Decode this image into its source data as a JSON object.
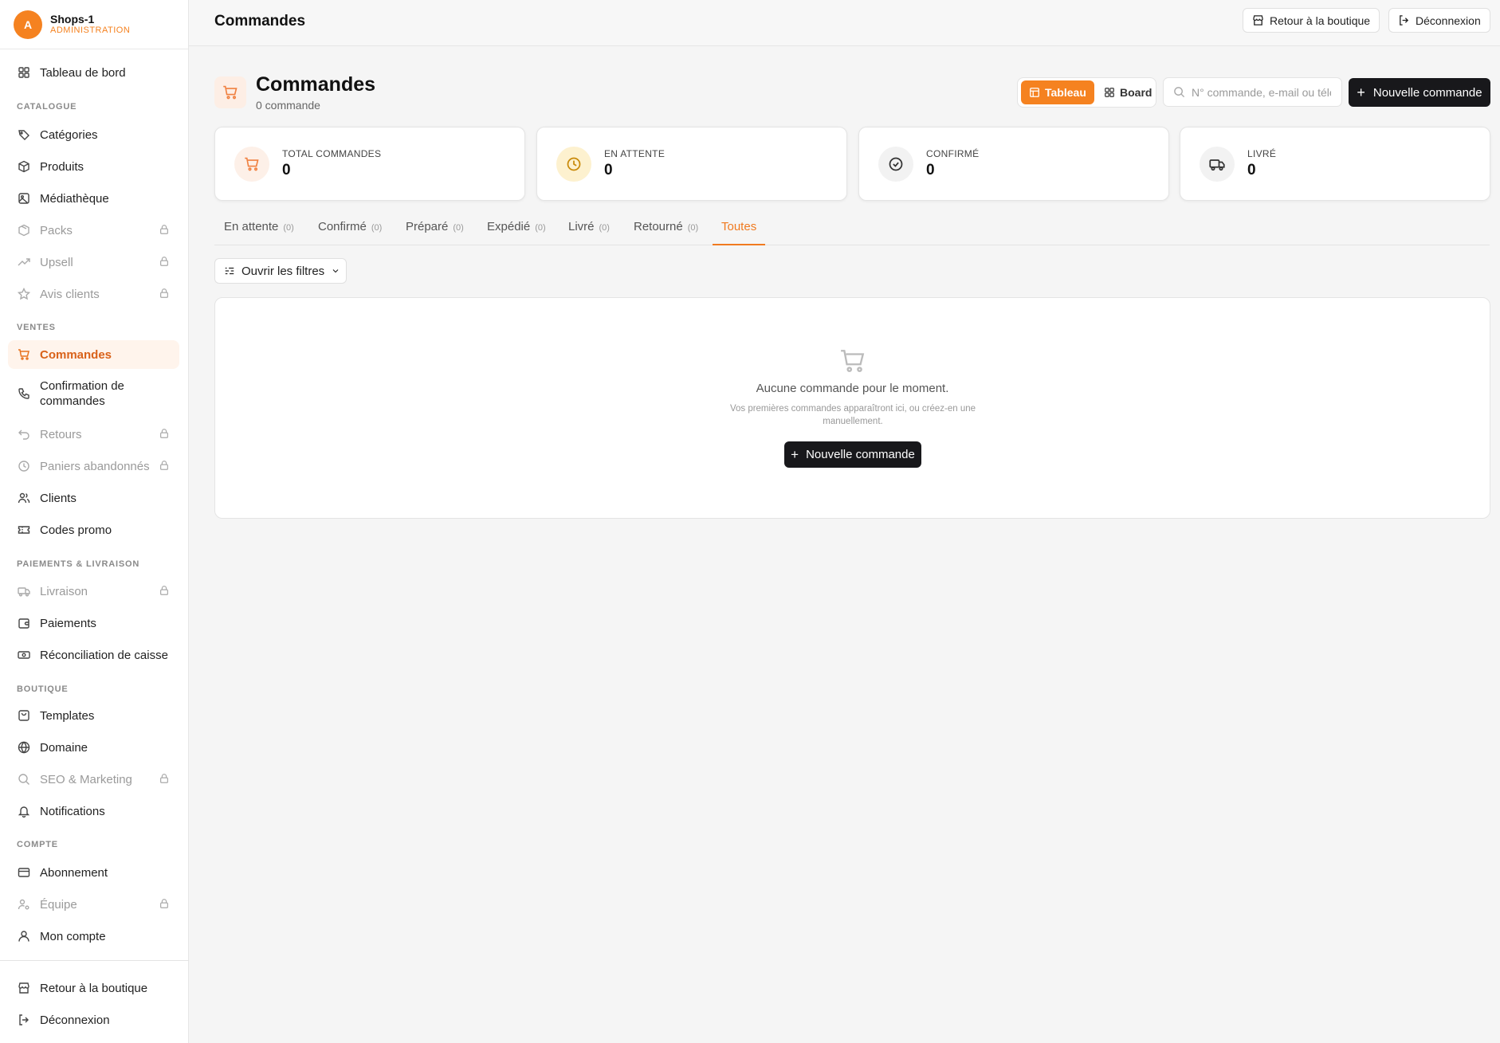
{
  "brand": {
    "initial": "A",
    "name": "Shops-1",
    "role": "ADMINISTRATION"
  },
  "sidebar": {
    "dashboard": "Tableau de bord",
    "sections": {
      "catalogue": "CATALOGUE",
      "ventes": "VENTES",
      "paiements": "PAIEMENTS & LIVRAISON",
      "boutique": "BOUTIQUE",
      "compte": "COMPTE"
    },
    "catalogue": [
      "Catégories",
      "Produits",
      "Médiathèque",
      "Packs",
      "Upsell",
      "Avis clients"
    ],
    "ventes": [
      "Commandes",
      "Confirmation de commandes",
      "Retours",
      "Paniers abandonnés",
      "Clients",
      "Codes promo"
    ],
    "paiements": [
      "Livraison",
      "Paiements",
      "Réconciliation de caisse"
    ],
    "boutique": [
      "Templates",
      "Domaine",
      "SEO & Marketing",
      "Notifications"
    ],
    "compte": [
      "Abonnement",
      "Équipe",
      "Mon compte"
    ],
    "bottom": [
      "Retour à la boutique",
      "Déconnexion"
    ]
  },
  "topbar": {
    "title": "Commandes",
    "back_label": "Retour à la boutique",
    "logout_label": "Déconnexion"
  },
  "header": {
    "title": "Commandes",
    "subtitle": "0 commande"
  },
  "view_toggle": {
    "table": "Tableau",
    "board": "Board",
    "selected": "Tableau"
  },
  "search": {
    "placeholder": "N° commande, e-mail ou téléphone",
    "value": ""
  },
  "new_order_label": "Nouvelle commande",
  "stats": [
    {
      "label": "TOTAL COMMANDES",
      "value": "0",
      "icon": "cart-icon"
    },
    {
      "label": "EN ATTENTE",
      "value": "0",
      "icon": "clock-icon"
    },
    {
      "label": "CONFIRMÉ",
      "value": "0",
      "icon": "check-circle-icon"
    },
    {
      "label": "LIVRÉ",
      "value": "0",
      "icon": "truck-icon"
    }
  ],
  "tabs": [
    {
      "label": "En attente",
      "count": "(0)"
    },
    {
      "label": "Confirmé",
      "count": "(0)"
    },
    {
      "label": "Préparé",
      "count": "(0)"
    },
    {
      "label": "Expédié",
      "count": "(0)"
    },
    {
      "label": "Livré",
      "count": "(0)"
    },
    {
      "label": "Retourné",
      "count": "(0)"
    },
    {
      "label": "Toutes",
      "count": ""
    }
  ],
  "active_tab": "Toutes",
  "filters_label": "Ouvrir les filtres",
  "empty": {
    "title": "Aucune commande pour le moment.",
    "subtitle": "Vos premières commandes apparaîtront ici, ou créez-en une manuellement.",
    "button": "Nouvelle commande"
  },
  "colors": {
    "accent": "#f58220",
    "dark": "#18181b",
    "active_bg": "#fff4ec"
  }
}
